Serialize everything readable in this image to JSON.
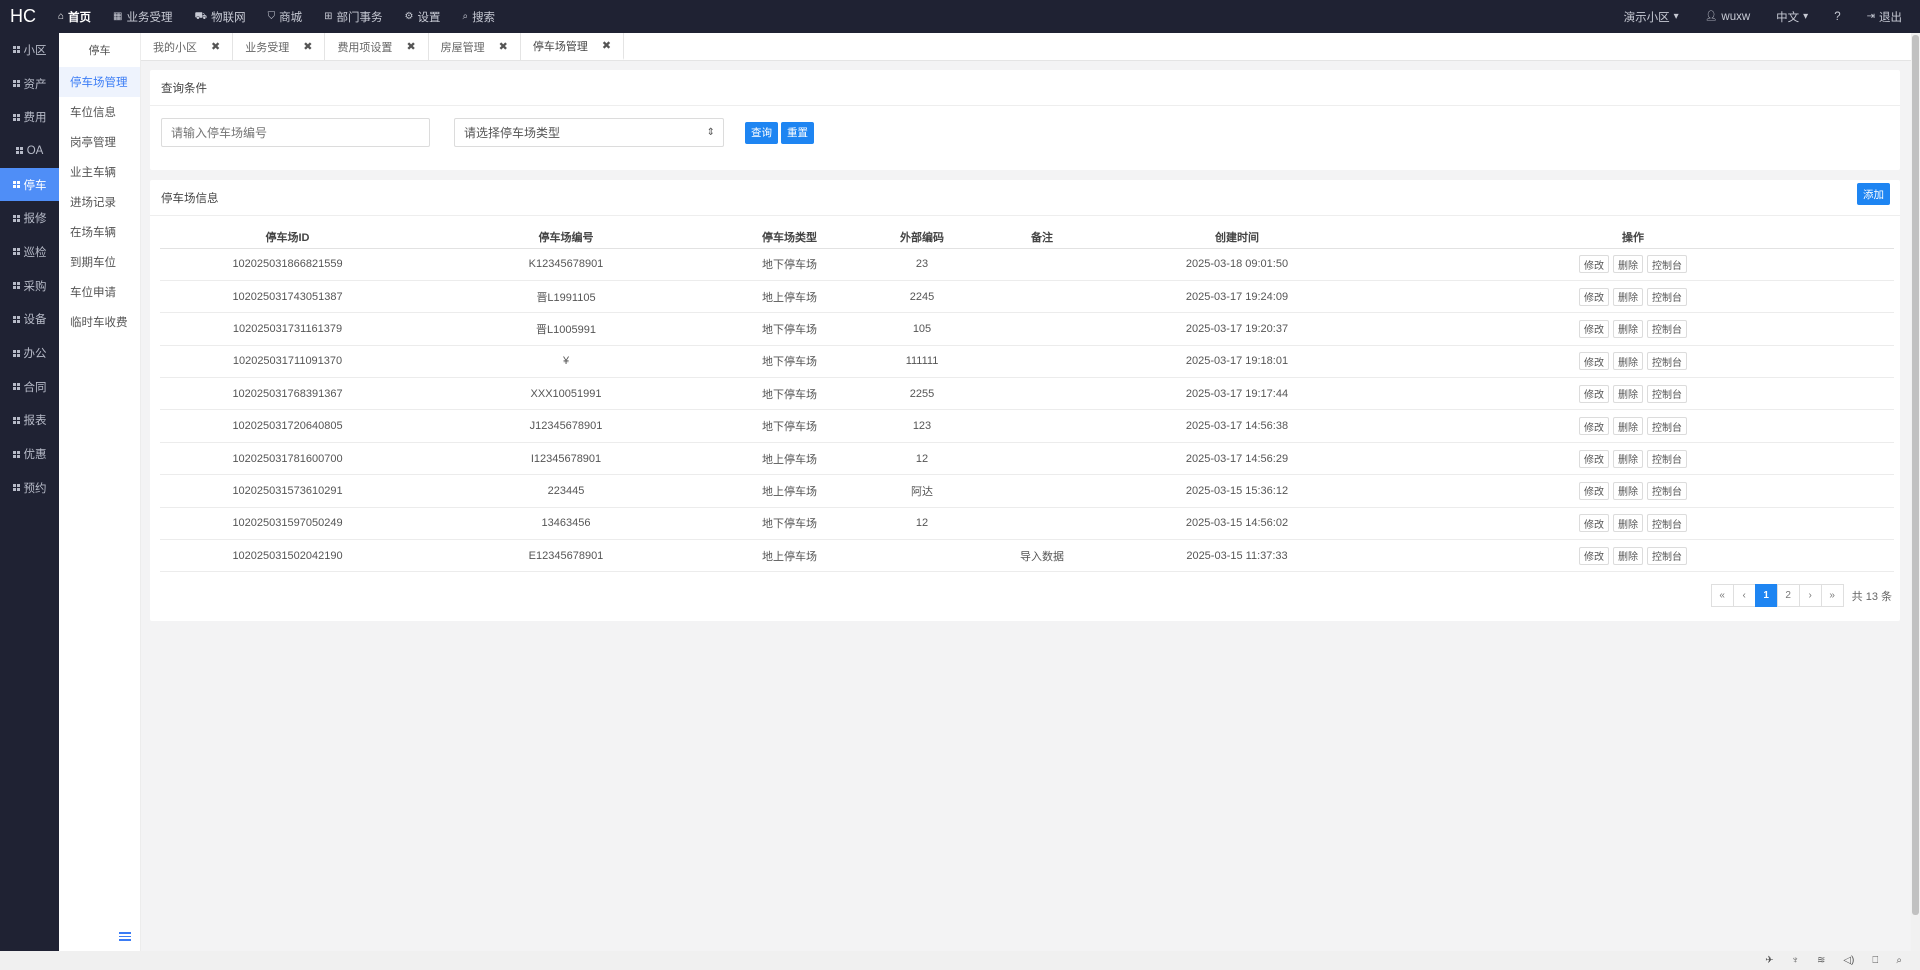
{
  "app": {
    "logo": "HC"
  },
  "topnav": [
    {
      "icon": "home-icon",
      "glyph": "⌂",
      "label": "首页",
      "active": true
    },
    {
      "icon": "dashboard-icon",
      "glyph": "▦",
      "label": "业务受理",
      "active": false
    },
    {
      "icon": "car-icon",
      "glyph": "⛟",
      "label": "物联网",
      "active": false
    },
    {
      "icon": "cart-icon",
      "glyph": "⛉",
      "label": "商城",
      "active": false
    },
    {
      "icon": "sitemap-icon",
      "glyph": "⊞",
      "label": "部门事务",
      "active": false
    },
    {
      "icon": "gear-icon",
      "glyph": "⚙",
      "label": "设置",
      "active": false
    },
    {
      "icon": "search-icon",
      "glyph": "⌕",
      "label": "搜索",
      "active": false
    }
  ],
  "topright": {
    "community": "演示小区",
    "user": "wuxw",
    "lang": "中文",
    "help_glyph": "?",
    "logout": "退出"
  },
  "rail": [
    {
      "label": "小区",
      "active": false
    },
    {
      "label": "资产",
      "active": false
    },
    {
      "label": "费用",
      "active": false
    },
    {
      "label": "OA",
      "active": false
    },
    {
      "label": "停车",
      "active": true
    },
    {
      "label": "报修",
      "active": false
    },
    {
      "label": "巡检",
      "active": false
    },
    {
      "label": "采购",
      "active": false
    },
    {
      "label": "设备",
      "active": false
    },
    {
      "label": "办公",
      "active": false
    },
    {
      "label": "合同",
      "active": false
    },
    {
      "label": "报表",
      "active": false
    },
    {
      "label": "优惠",
      "active": false
    },
    {
      "label": "预约",
      "active": false
    }
  ],
  "submenu": {
    "header": "停车",
    "items": [
      {
        "label": "停车场管理",
        "active": true
      },
      {
        "label": "车位信息",
        "active": false
      },
      {
        "label": "岗亭管理",
        "active": false
      },
      {
        "label": "业主车辆",
        "active": false
      },
      {
        "label": "进场记录",
        "active": false
      },
      {
        "label": "在场车辆",
        "active": false
      },
      {
        "label": "到期车位",
        "active": false
      },
      {
        "label": "车位申请",
        "active": false
      },
      {
        "label": "临时车收费",
        "active": false
      }
    ]
  },
  "tabs": [
    {
      "label": "我的小区",
      "active": false
    },
    {
      "label": "业务受理",
      "active": false
    },
    {
      "label": "费用项设置",
      "active": false
    },
    {
      "label": "房屋管理",
      "active": false
    },
    {
      "label": "停车场管理",
      "active": true
    }
  ],
  "search": {
    "title": "查询条件",
    "input_placeholder": "请输入停车场编号",
    "select_value": "请选择停车场类型",
    "query_label": "查询",
    "reset_label": "重置"
  },
  "list": {
    "title": "停车场信息",
    "add_label": "添加",
    "columns": [
      "停车场ID",
      "停车场编号",
      "停车场类型",
      "外部编码",
      "备注",
      "创建时间",
      "操作"
    ],
    "rows": [
      {
        "id": "102025031866821559",
        "num": "K12345678901",
        "type": "地下停车场",
        "ext": "23",
        "remark": "",
        "time": "2025-03-18 09:01:50"
      },
      {
        "id": "102025031743051387",
        "num": "晋L1991105",
        "type": "地上停车场",
        "ext": "2245",
        "remark": "",
        "time": "2025-03-17 19:24:09"
      },
      {
        "id": "102025031731161379",
        "num": "晋L1005991",
        "type": "地下停车场",
        "ext": "105",
        "remark": "",
        "time": "2025-03-17 19:20:37"
      },
      {
        "id": "102025031711091370",
        "num": "¥",
        "type": "地下停车场",
        "ext": "111111",
        "remark": "",
        "time": "2025-03-17 19:18:01"
      },
      {
        "id": "102025031768391367",
        "num": "XXX10051991",
        "type": "地下停车场",
        "ext": "2255",
        "remark": "",
        "time": "2025-03-17 19:17:44"
      },
      {
        "id": "102025031720640805",
        "num": "J12345678901",
        "type": "地下停车场",
        "ext": "123",
        "remark": "",
        "time": "2025-03-17 14:56:38"
      },
      {
        "id": "102025031781600700",
        "num": "I12345678901",
        "type": "地上停车场",
        "ext": "12",
        "remark": "",
        "time": "2025-03-17 14:56:29"
      },
      {
        "id": "102025031573610291",
        "num": "223445",
        "type": "地上停车场",
        "ext": "阿达",
        "remark": "",
        "time": "2025-03-15 15:36:12"
      },
      {
        "id": "102025031597050249",
        "num": "13463456",
        "type": "地下停车场",
        "ext": "12",
        "remark": "",
        "time": "2025-03-15 14:56:02"
      },
      {
        "id": "102025031502042190",
        "num": "E12345678901",
        "type": "地上停车场",
        "ext": "",
        "remark": "导入数据",
        "time": "2025-03-15 11:37:33"
      }
    ],
    "ops": [
      "修改",
      "删除",
      "控制台"
    ]
  },
  "pager": {
    "buttons": [
      "«",
      "‹",
      "1",
      "2",
      "›",
      "»"
    ],
    "active_page": "1",
    "total": "共 13 条"
  },
  "taskbar": [
    "✈",
    "♆",
    "≋",
    "◁)",
    "⎕",
    "⌕"
  ]
}
